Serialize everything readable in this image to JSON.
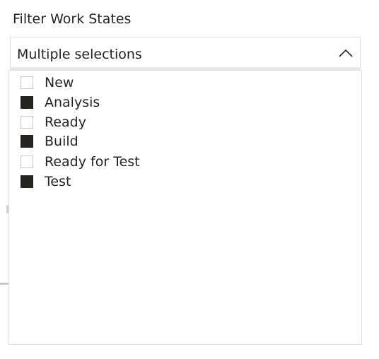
{
  "slicer": {
    "title": "Filter Work States",
    "selected_text": "Multiple selections",
    "expanded_icon": "chevron-up-icon",
    "items": [
      {
        "label": "New",
        "checked": false
      },
      {
        "label": "Analysis",
        "checked": true
      },
      {
        "label": "Ready",
        "checked": false
      },
      {
        "label": "Build",
        "checked": true
      },
      {
        "label": "Ready for Test",
        "checked": false
      },
      {
        "label": "Test",
        "checked": true
      }
    ]
  },
  "colors": {
    "text": "#252423",
    "border": "#e1dfdd",
    "checkbox_checked": "#252423",
    "checkbox_border": "#c8c6c4"
  }
}
